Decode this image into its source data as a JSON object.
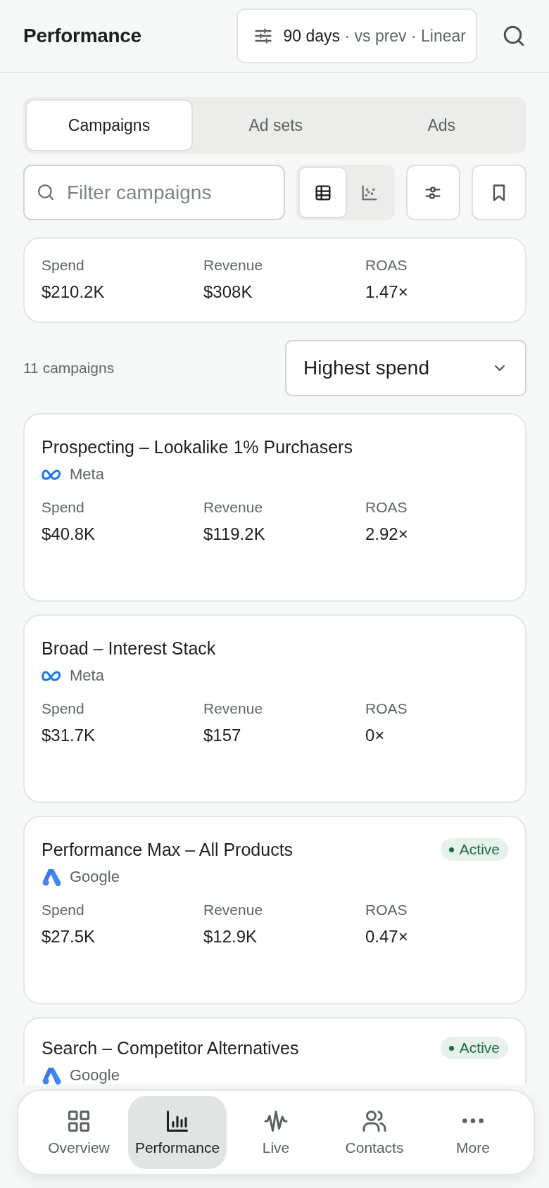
{
  "header": {
    "title": "Performance",
    "range_button": {
      "primary": "90 days",
      "secondary": "· vs prev · Linear"
    }
  },
  "tabs": [
    {
      "label": "Campaigns",
      "selected": true
    },
    {
      "label": "Ad sets",
      "selected": false
    },
    {
      "label": "Ads",
      "selected": false
    }
  ],
  "search": {
    "placeholder": "Filter campaigns"
  },
  "view_toggle": [
    {
      "kind": "table",
      "selected": true
    },
    {
      "kind": "scatter",
      "selected": false
    }
  ],
  "summary": [
    {
      "label": "Spend",
      "value": "$210.2K"
    },
    {
      "label": "Revenue",
      "value": "$308K"
    },
    {
      "label": "ROAS",
      "value": "1.47×"
    }
  ],
  "count": "11 campaigns",
  "sort": {
    "value": "Highest spend"
  },
  "campaigns": [
    {
      "name": "Prospecting – Lookalike 1% Purchasers",
      "platform": {
        "kind": "meta",
        "label": "Meta"
      },
      "stats": [
        {
          "label": "Spend",
          "value": "$40.8K"
        },
        {
          "label": "Revenue",
          "value": "$119.2K"
        },
        {
          "label": "ROAS",
          "value": "2.92×"
        }
      ]
    },
    {
      "name": "Broad – Interest Stack",
      "platform": {
        "kind": "meta",
        "label": "Meta"
      },
      "stats": [
        {
          "label": "Spend",
          "value": "$31.7K"
        },
        {
          "label": "Revenue",
          "value": "$157"
        },
        {
          "label": "ROAS",
          "value": "0×"
        }
      ]
    },
    {
      "name": "Performance Max – All Products",
      "status": "Active",
      "platform": {
        "kind": "google",
        "label": "Google"
      },
      "stats": [
        {
          "label": "Spend",
          "value": "$27.5K"
        },
        {
          "label": "Revenue",
          "value": "$12.9K"
        },
        {
          "label": "ROAS",
          "value": "0.47×"
        }
      ]
    },
    {
      "name": "Search – Competitor Alternatives",
      "status": "Active",
      "platform": {
        "kind": "google",
        "label": "Google"
      }
    }
  ],
  "nav": [
    {
      "kind": "overview",
      "label": "Overview",
      "selected": false
    },
    {
      "kind": "performance",
      "label": "Performance",
      "selected": true
    },
    {
      "kind": "live",
      "label": "Live",
      "selected": false
    },
    {
      "kind": "contacts",
      "label": "Contacts",
      "selected": false
    },
    {
      "kind": "more",
      "label": "More",
      "selected": false
    }
  ]
}
